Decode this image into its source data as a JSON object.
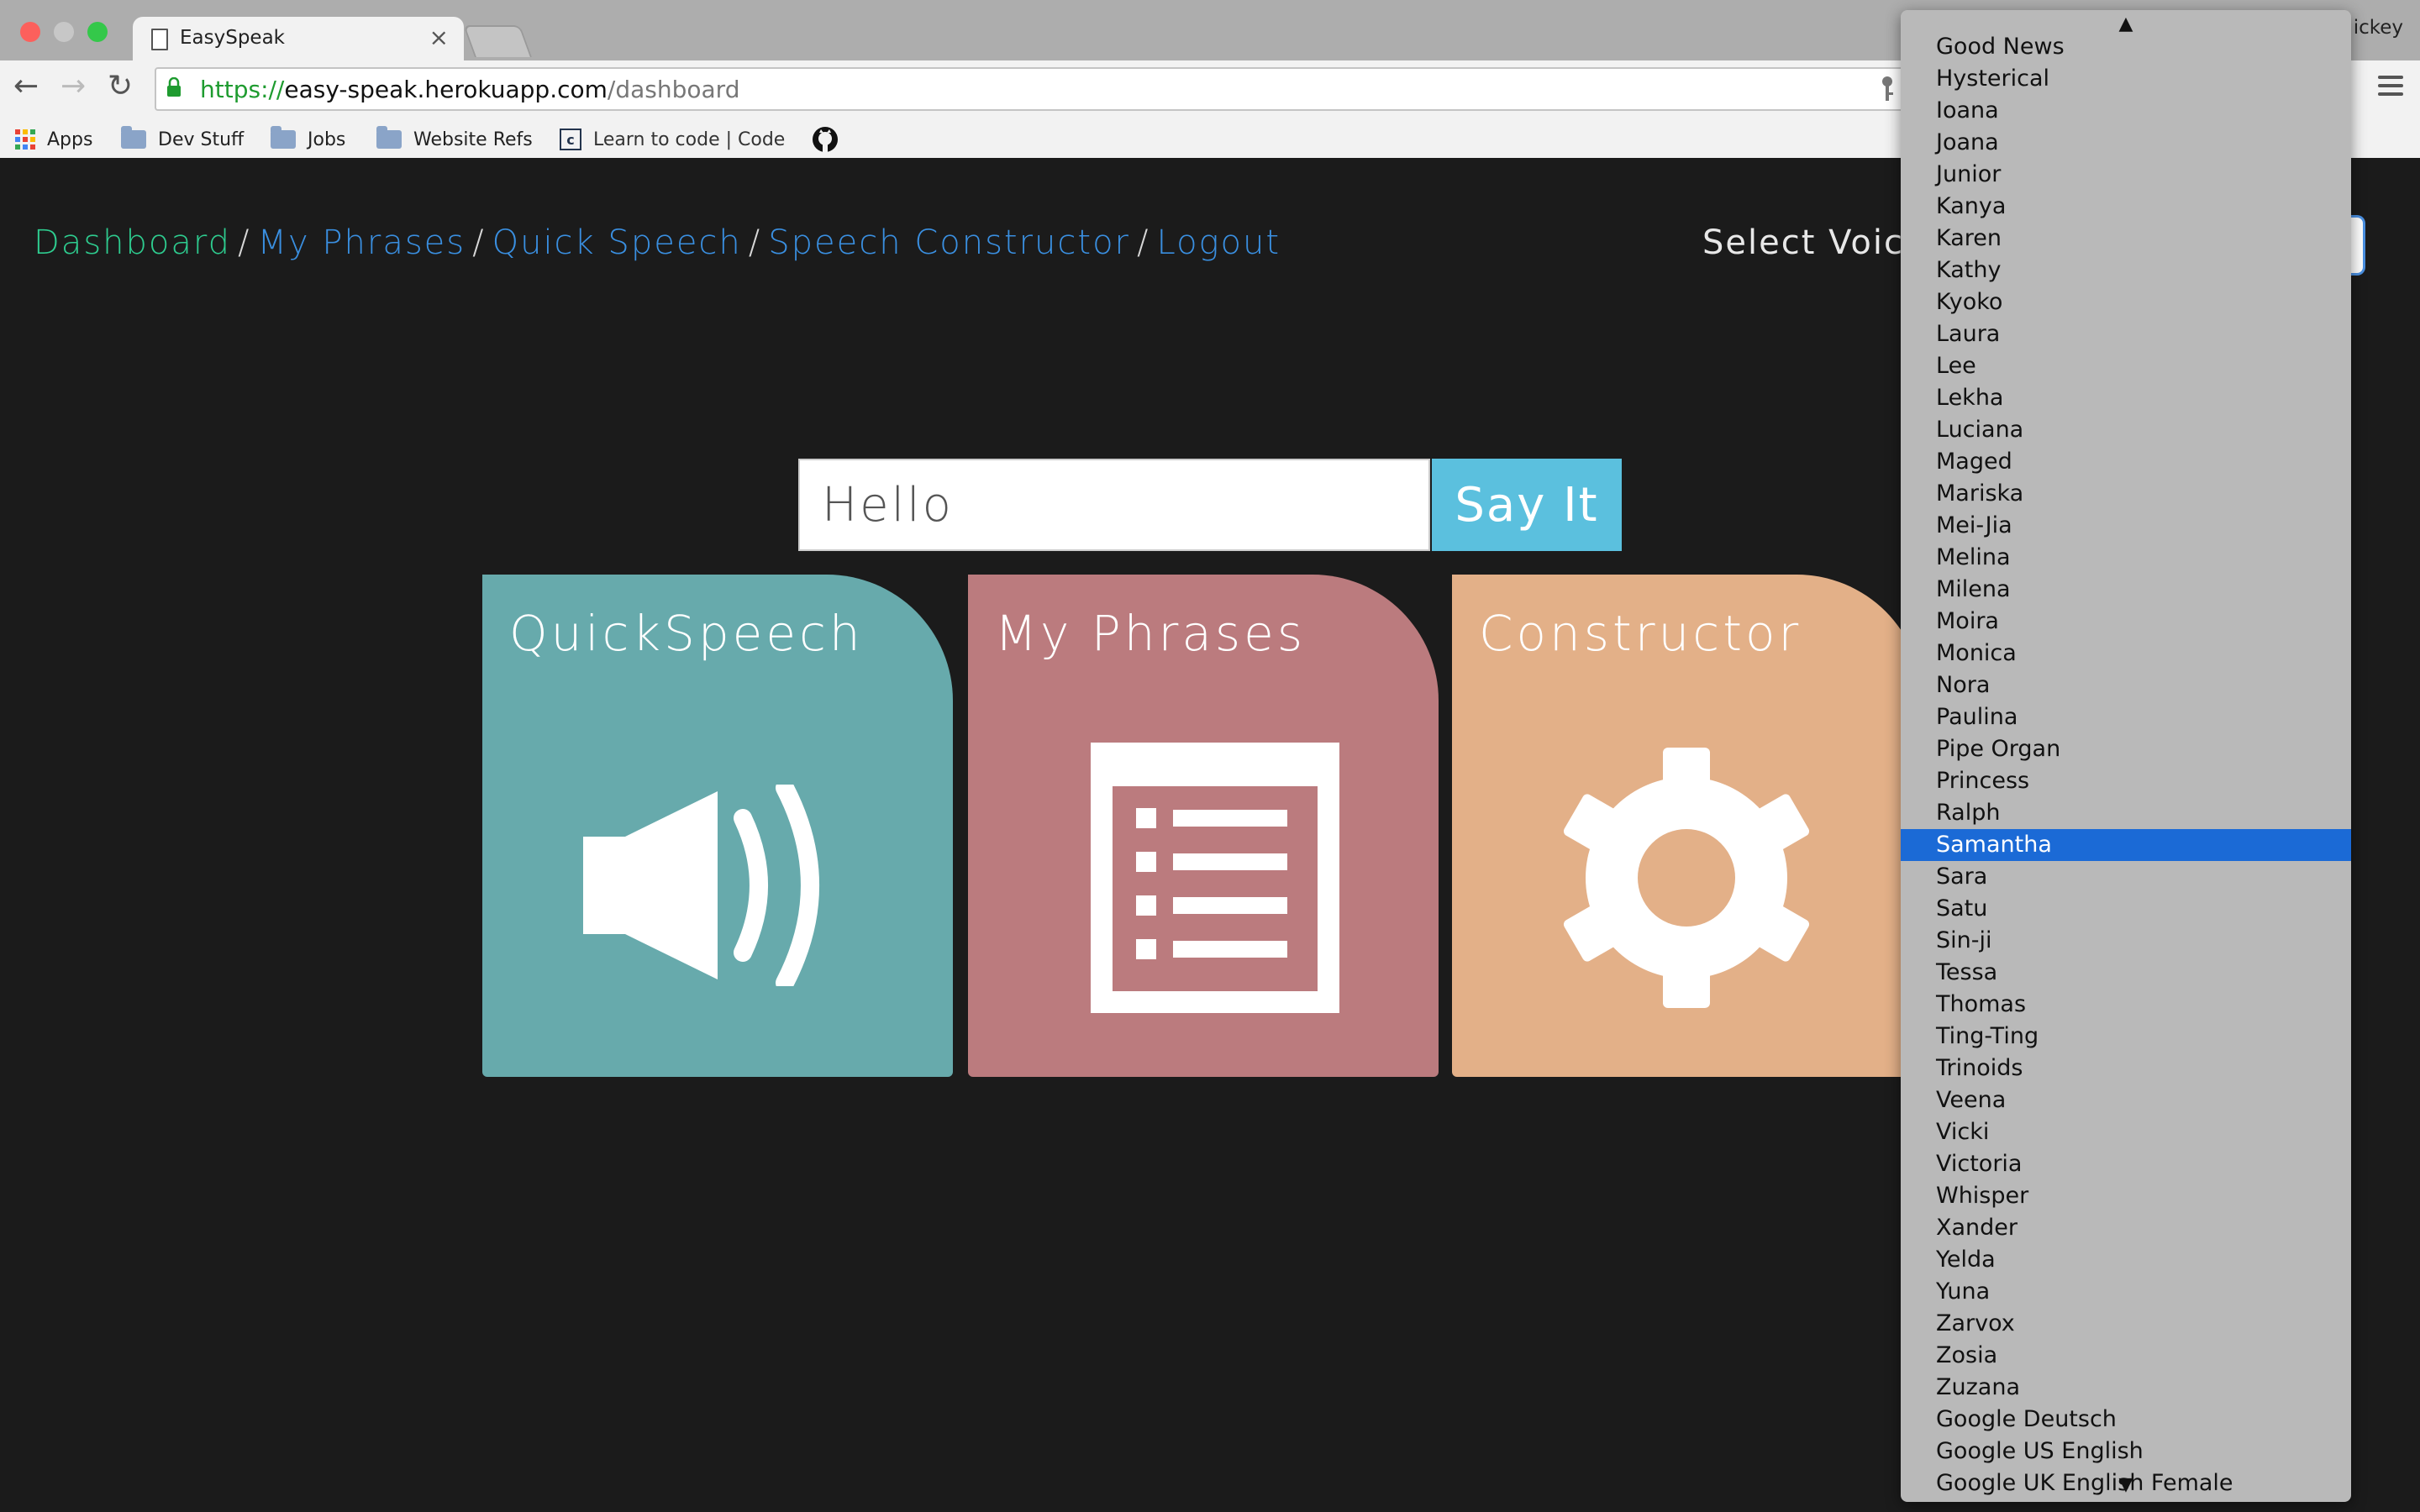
{
  "browser": {
    "tab_title": "EasySpeak",
    "tab_close": "×",
    "profile_name": "ickey",
    "url_scheme": "https://",
    "url_host": "easy-speak.herokuapp.com",
    "url_path": "/dashboard",
    "back_glyph": "←",
    "forward_glyph": "→",
    "reload_glyph": "↻",
    "bookmarks": [
      {
        "label": "Apps",
        "icon": "apps-grid-icon"
      },
      {
        "label": "Dev Stuff",
        "icon": "folder-icon"
      },
      {
        "label": "Jobs",
        "icon": "folder-icon"
      },
      {
        "label": "Website Refs",
        "icon": "folder-icon"
      },
      {
        "label": "Learn to code | Code",
        "icon": "codecademy-icon"
      },
      {
        "label": "",
        "icon": "github-icon"
      }
    ],
    "colors": {
      "light_red": "#fc605c",
      "light_yellow": "#c7c7c7",
      "light_green": "#34c84a"
    }
  },
  "nav": {
    "dashboard": "Dashboard",
    "my_phrases": "My Phrases",
    "quick_speech": "Quick Speech",
    "speech_constructor": "Speech Constructor",
    "logout": "Logout",
    "separator": "/",
    "select_voice_label": "Select Voice",
    "colors": {
      "active": "#2ecc8f",
      "link": "#3a8fe0"
    }
  },
  "say": {
    "input_value": "Hello",
    "button_label": "Say It"
  },
  "cards": [
    {
      "title": "QuickSpeech",
      "color": "#67aaac",
      "icon": "speaker-icon"
    },
    {
      "title": "My Phrases",
      "color": "#bb7b7e",
      "icon": "list-icon"
    },
    {
      "title": "Constructor",
      "color": "#e3b088",
      "icon": "gear-icon"
    }
  ],
  "voice_dropdown": {
    "scroll_up_glyph": "▲",
    "scroll_down_glyph": "▼",
    "selected": "Samantha",
    "selected_color": "#1b6ad6",
    "options": [
      "Good News",
      "Hysterical",
      "Ioana",
      "Joana",
      "Junior",
      "Kanya",
      "Karen",
      "Kathy",
      "Kyoko",
      "Laura",
      "Lee",
      "Lekha",
      "Luciana",
      "Maged",
      "Mariska",
      "Mei-Jia",
      "Melina",
      "Milena",
      "Moira",
      "Monica",
      "Nora",
      "Paulina",
      "Pipe Organ",
      "Princess",
      "Ralph",
      "Samantha",
      "Sara",
      "Satu",
      "Sin-ji",
      "Tessa",
      "Thomas",
      "Ting-Ting",
      "Trinoids",
      "Veena",
      "Vicki",
      "Victoria",
      "Whisper",
      "Xander",
      "Yelda",
      "Yuna",
      "Zarvox",
      "Zosia",
      "Zuzana",
      "Google Deutsch",
      "Google US English",
      "Google UK English Female"
    ]
  }
}
